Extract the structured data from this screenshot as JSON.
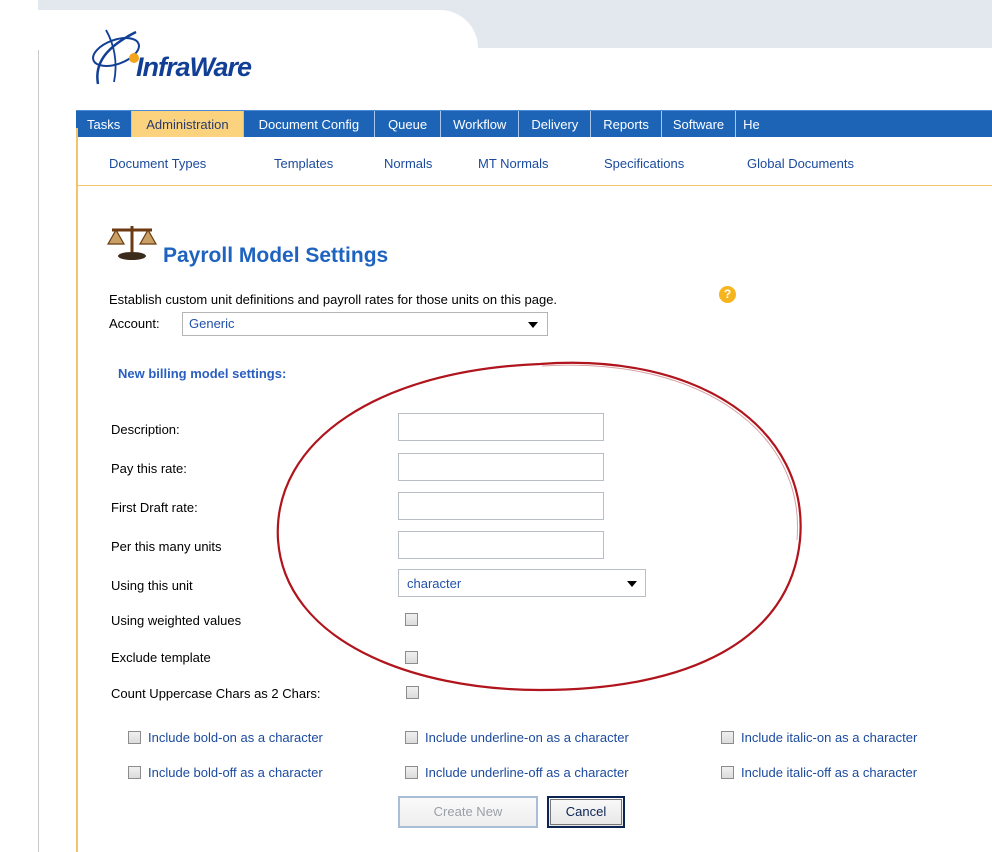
{
  "brand": {
    "logo_text": "InfraWare"
  },
  "main_nav": {
    "tabs": [
      {
        "label": "Tasks"
      },
      {
        "label": "Administration",
        "active": true
      },
      {
        "label": "Document Config"
      },
      {
        "label": "Queue"
      },
      {
        "label": "Workflow"
      },
      {
        "label": "Delivery"
      },
      {
        "label": "Reports"
      },
      {
        "label": "Software"
      },
      {
        "label": "He"
      }
    ]
  },
  "sub_nav": {
    "items": [
      {
        "label": "Document Types"
      },
      {
        "label": "Templates"
      },
      {
        "label": "Normals"
      },
      {
        "label": "MT Normals"
      },
      {
        "label": "Specifications"
      },
      {
        "label": "Global Documents"
      }
    ]
  },
  "page": {
    "title": "Payroll Model Settings",
    "description": "Establish custom unit definitions and payroll rates for those units on this page.",
    "help_icon": "question-icon",
    "title_icon": "scales-icon"
  },
  "account": {
    "label": "Account:",
    "value": "Generic"
  },
  "form": {
    "heading": "New billing model settings:",
    "description_label": "Description:",
    "description_value": "",
    "pay_rate_label": "Pay this rate:",
    "pay_rate_value": "",
    "first_draft_label": "First Draft rate:",
    "first_draft_value": "",
    "per_units_label": "Per this many units",
    "per_units_value": "",
    "unit_label": "Using this unit",
    "unit_value": "character",
    "weighted_label": "Using weighted values",
    "weighted_checked": false,
    "exclude_template_label": "Exclude template",
    "exclude_template_checked": false,
    "uppercase_label": "Count Uppercase Chars as 2 Chars:",
    "uppercase_checked": false,
    "include_options": [
      {
        "label": "Include bold-on as a character",
        "checked": false
      },
      {
        "label": "Include underline-on as a character",
        "checked": false
      },
      {
        "label": "Include italic-on as a character",
        "checked": false
      },
      {
        "label": "Include bold-off as a character",
        "checked": false
      },
      {
        "label": "Include underline-off as a character",
        "checked": false
      },
      {
        "label": "Include italic-off as a character",
        "checked": false
      }
    ],
    "create_label": "Create New",
    "cancel_label": "Cancel"
  },
  "colors": {
    "nav_blue": "#1d64b7",
    "active_tab": "#fbd27e",
    "title_blue": "#1e63c0",
    "link_blue": "#1a4a9e",
    "annotation_red": "#b0141c"
  }
}
